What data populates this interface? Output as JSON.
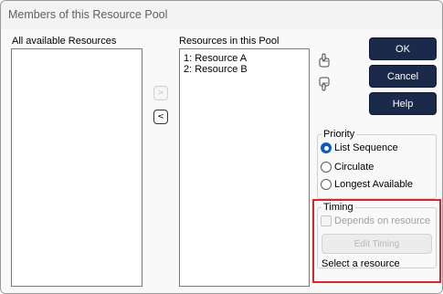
{
  "window": {
    "title": "Members of this Resource Pool"
  },
  "available": {
    "label": "All available Resources",
    "items": []
  },
  "pool": {
    "label": "Resources in this Pool",
    "items": [
      "1: Resource A",
      "2: Resource B"
    ]
  },
  "transfer": {
    "add_glyph": ">",
    "remove_glyph": "<"
  },
  "buttons": {
    "ok": "OK",
    "cancel": "Cancel",
    "help": "Help"
  },
  "priority": {
    "title": "Priority",
    "options": [
      {
        "label": "List Sequence",
        "checked": true
      },
      {
        "label": "Circulate",
        "checked": false
      },
      {
        "label": "Longest Available",
        "checked": false
      }
    ]
  },
  "timing": {
    "title": "Timing",
    "depends_label": "Depends on resource",
    "depends_checked": false,
    "edit_button": "Edit Timing",
    "status": "Select a resource"
  },
  "icons": {
    "move_up": "hand-up-icon",
    "move_down": "hand-down-icon"
  },
  "colors": {
    "primary_button": "#1b2a4a",
    "radio_selected": "#0a5cc2",
    "highlight_box": "#d8262c"
  }
}
